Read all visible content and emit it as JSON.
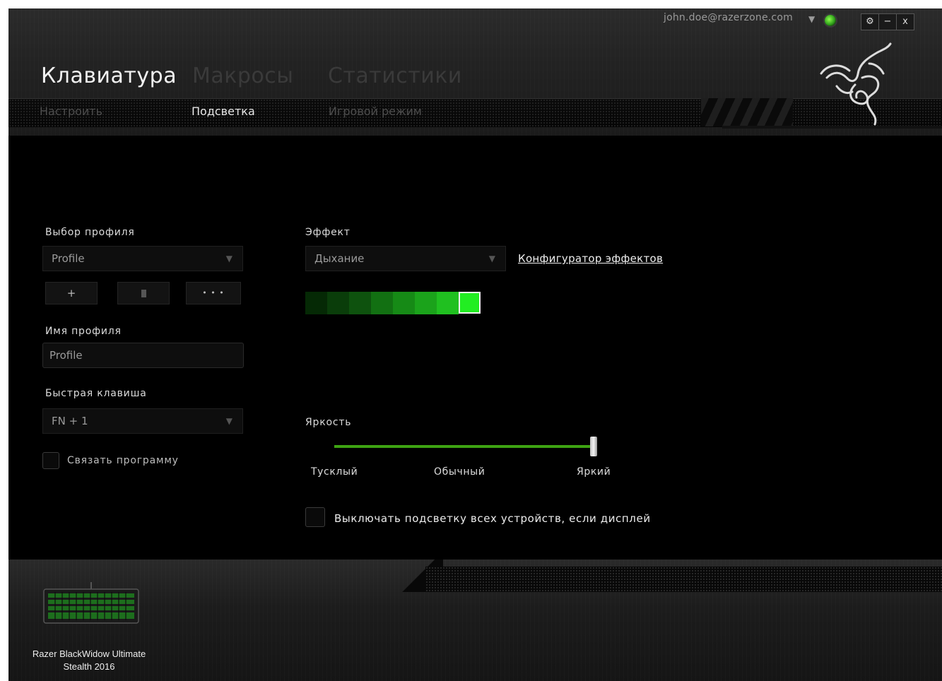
{
  "account": {
    "email": "john.doe@razerzone.com",
    "caret": "▼"
  },
  "window_controls": {
    "settings": "⚙",
    "minimize": "−",
    "close": "x"
  },
  "tabs": [
    {
      "label": "Клавиатура",
      "active": true
    },
    {
      "label": "Макросы",
      "active": false
    },
    {
      "label": "Статистики",
      "active": false
    }
  ],
  "subtabs": [
    {
      "label": "Настроить",
      "active": false
    },
    {
      "label": "Подсветка",
      "active": true
    },
    {
      "label": "Игровой режим",
      "active": false
    }
  ],
  "profile": {
    "select_label": "Выбор профиля",
    "selected": "Profile",
    "add_label": "+",
    "more_label": "• • •",
    "name_label": "Имя профиля",
    "name_value": "Profile",
    "hotkey_label": "Быстрая клавиша",
    "hotkey_value": "FN + 1",
    "link_program_label": "Связать программу"
  },
  "effect": {
    "label": "Эффект",
    "selected": "Дыхание",
    "config_link": "Конфигуратор эффектов",
    "color_swatches": [
      "#052905",
      "#0a3d0a",
      "#0e520e",
      "#127012",
      "#168a16",
      "#1ba31b",
      "#20c020"
    ],
    "active_color": "#22ee22"
  },
  "brightness": {
    "label": "Яркость",
    "min_label": "Тусклый",
    "mid_label": "Обычный",
    "max_label": "Яркий",
    "value_percent": 100,
    "accent_color": "#3ea312"
  },
  "display_off": {
    "label": "Выключать подсветку всех устройств, если дисплей"
  },
  "device": {
    "name_line1": "Razer BlackWidow Ultimate",
    "name_line2": "Stealth 2016"
  }
}
